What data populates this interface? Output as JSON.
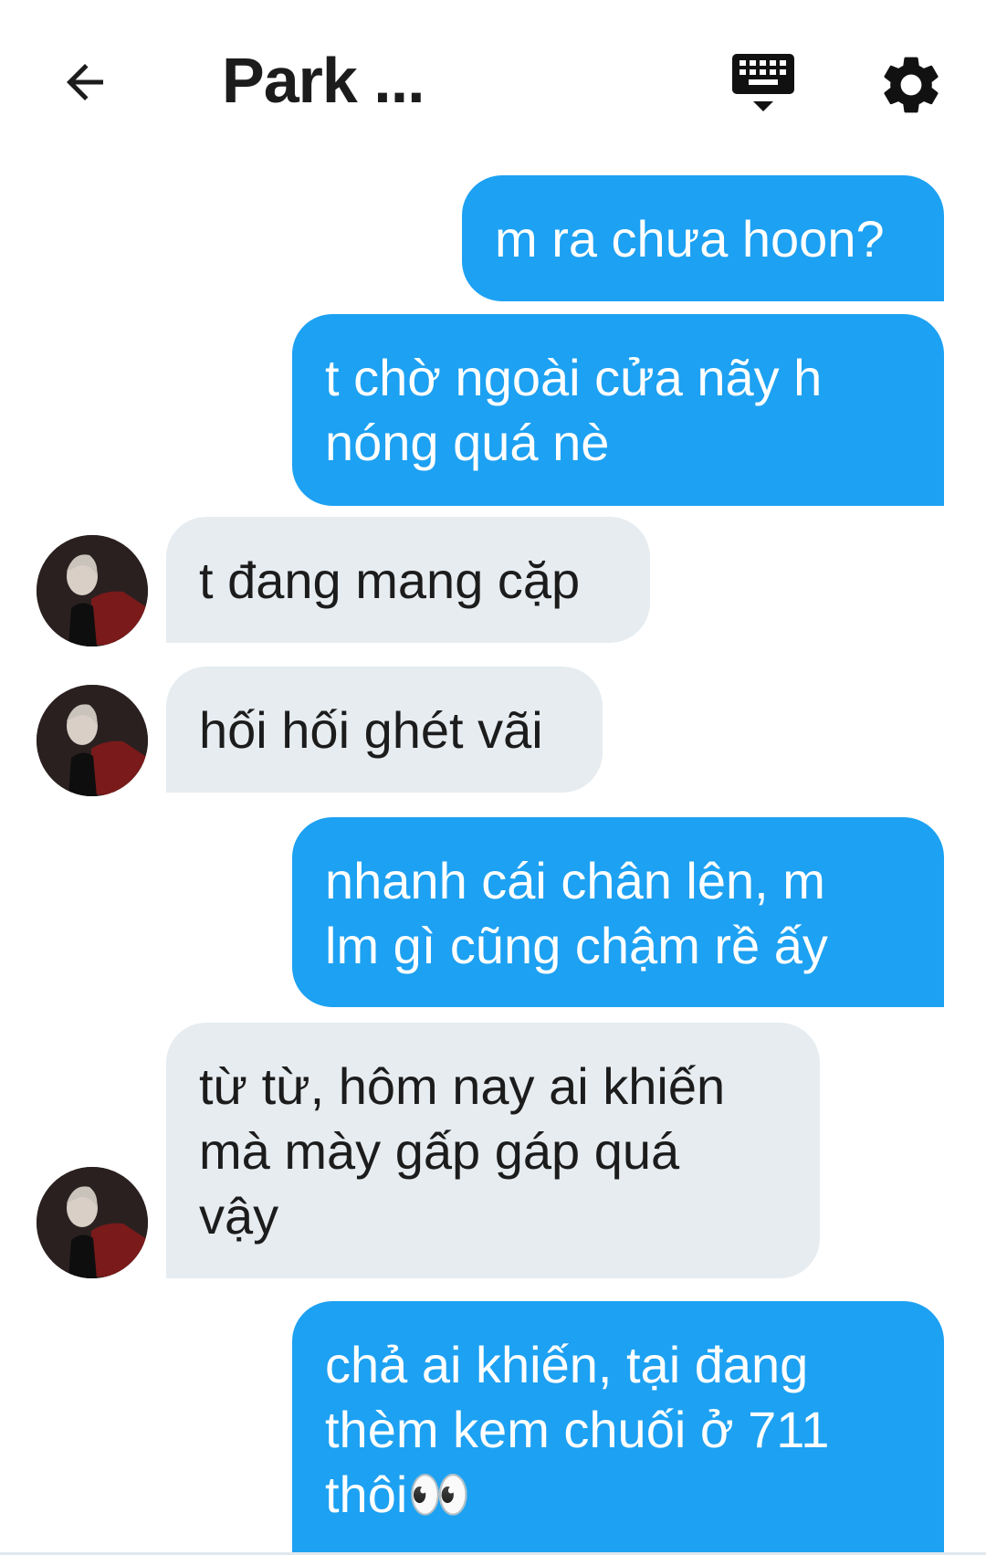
{
  "header": {
    "title": "Park ...",
    "back_icon": "arrow-left-icon",
    "keyboard_icon": "keyboard-hide-icon",
    "settings_icon": "gear-icon"
  },
  "colors": {
    "outgoing_bubble": "#1da1f2",
    "incoming_bubble": "#e6ecf0",
    "incoming_text": "#1c1c1c",
    "outgoing_text": "#ffffff"
  },
  "messages": [
    {
      "direction": "outgoing",
      "text": "m ra chưa hoon?"
    },
    {
      "direction": "outgoing",
      "text": "t chờ ngoài cửa nãy h\nnóng quá nè"
    },
    {
      "direction": "incoming",
      "text": "t đang mang cặp"
    },
    {
      "direction": "incoming",
      "text": "hối hối ghét vãi"
    },
    {
      "direction": "outgoing",
      "text": "nhanh cái chân lên, m\nlm gì cũng chậm rề ấy"
    },
    {
      "direction": "incoming",
      "text": "từ từ, hôm nay ai khiến\nmà mày gấp gáp quá\nvậy"
    },
    {
      "direction": "outgoing",
      "text": "chả ai khiến, tại đang\nthèm kem chuối ở 711\nthôi👀"
    }
  ]
}
